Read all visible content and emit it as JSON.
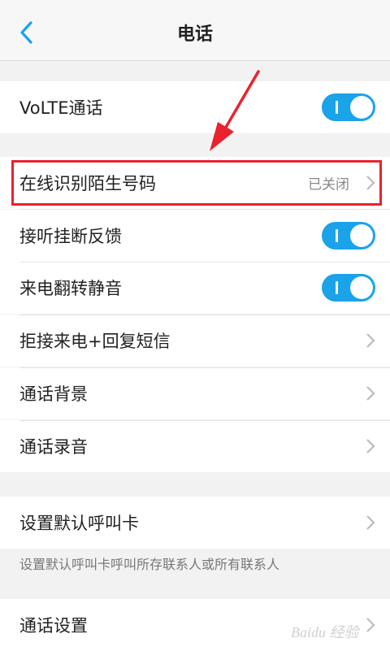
{
  "header": {
    "title": "电话"
  },
  "rows": [
    {
      "label": "VoLTE通话",
      "control": "toggle",
      "state": "on"
    },
    {
      "label": "在线识别陌生号码",
      "value": "已关闭",
      "control": "chevron"
    },
    {
      "label": "接听挂断反馈",
      "control": "toggle",
      "state": "on"
    },
    {
      "label": "来电翻转静音",
      "control": "toggle",
      "state": "on"
    },
    {
      "label": "拒接来电+回复短信",
      "control": "chevron"
    },
    {
      "label": "通话背景",
      "control": "chevron"
    },
    {
      "label": "通话录音",
      "control": "chevron"
    },
    {
      "label": "设置默认呼叫卡",
      "control": "chevron"
    },
    {
      "label": "通话设置",
      "control": "chevron"
    }
  ],
  "default_card_note": "设置默认呼叫卡呼叫所存联系人或所有联系人",
  "colors": {
    "accent": "#1aa3e8",
    "highlight": "#e8232d"
  },
  "icons": [
    "back-arrow-icon",
    "chevron-right-icon"
  ]
}
